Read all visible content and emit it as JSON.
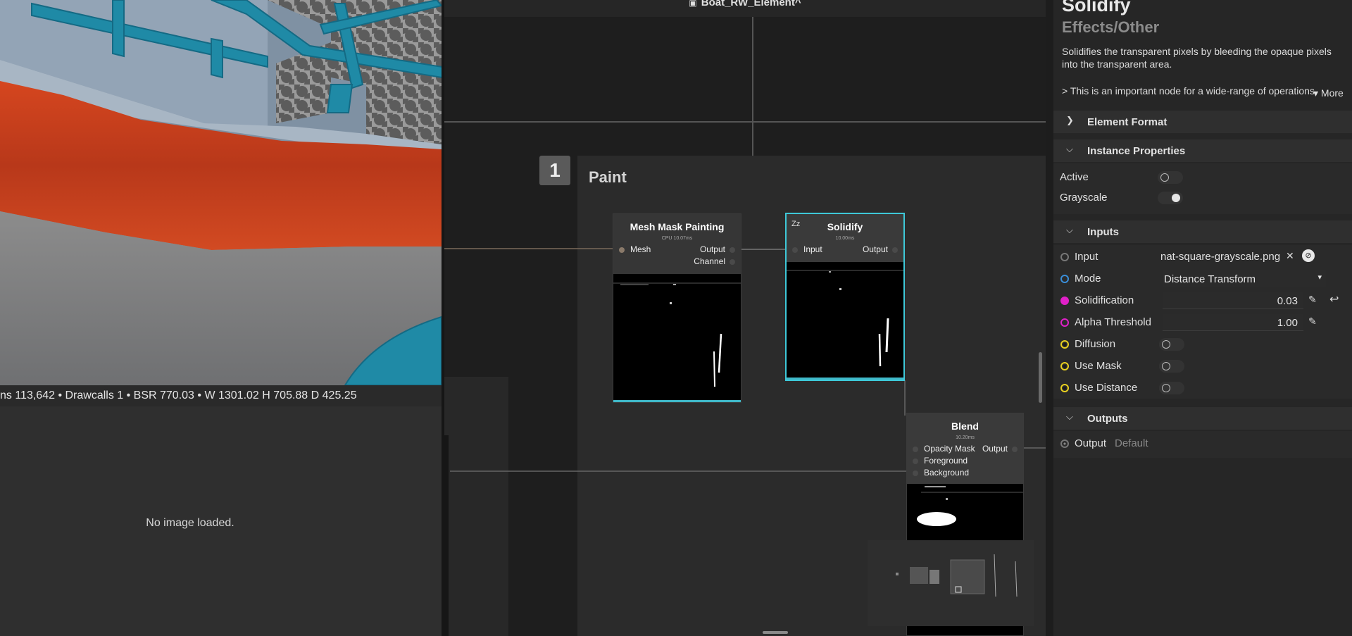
{
  "viewport": {
    "stats": "ns 113,642 • Drawcalls 1 • BSR 770.03 • W 1301.02 H 705.88 D 425.25"
  },
  "image_panel": {
    "empty_text": "No image loaded."
  },
  "graph": {
    "title": "Boat_RW_Element^",
    "frame": {
      "number": "1",
      "title": "Paint"
    },
    "nodes": {
      "mesh_mask": {
        "title": "Mesh Mask Painting",
        "time": "CPU 10.07ms",
        "ports": {
          "in_mesh": "Mesh",
          "out_output": "Output",
          "out_channel": "Channel"
        }
      },
      "solidify": {
        "title": "Solidify",
        "time": "10.00ms",
        "ports": {
          "in_input": "Input",
          "out_output": "Output"
        }
      },
      "blend": {
        "title": "Blend",
        "time": "10.20ms",
        "ports": {
          "in_opacity": "Opacity Mask",
          "in_fg": "Foreground",
          "in_bg": "Background",
          "out_output": "Output"
        }
      }
    }
  },
  "props": {
    "title": "Solidify",
    "category": "Effects/Other",
    "description": "Solidifies the transparent pixels by bleeding the opaque pixels into the transparent area.",
    "note": "> This is an important node for a wide-range of operations",
    "more_label": "More",
    "sections": {
      "element_format": "Element Format",
      "instance_properties": "Instance Properties",
      "inputs": "Inputs",
      "outputs": "Outputs"
    },
    "instance": {
      "active": {
        "label": "Active",
        "on": false
      },
      "grayscale": {
        "label": "Grayscale",
        "on": true
      }
    },
    "inputs": {
      "input": {
        "label": "Input",
        "value": "nat-square-grayscale.png"
      },
      "mode": {
        "label": "Mode",
        "value": "Distance Transform"
      },
      "solidification": {
        "label": "Solidification",
        "value": "0.03"
      },
      "alpha_threshold": {
        "label": "Alpha Threshold",
        "value": "1.00"
      },
      "diffusion": {
        "label": "Diffusion",
        "on": false
      },
      "use_mask": {
        "label": "Use Mask",
        "on": false
      },
      "use_distance": {
        "label": "Use Distance",
        "on": false
      }
    },
    "outputs": {
      "output": {
        "label": "Output",
        "value": "Default"
      }
    },
    "colors": {
      "accent_cyan": "#3ec8d8",
      "port_magenta": "#e020c8",
      "port_yellow": "#e8d020",
      "port_blue": "#3a8ed8"
    }
  }
}
